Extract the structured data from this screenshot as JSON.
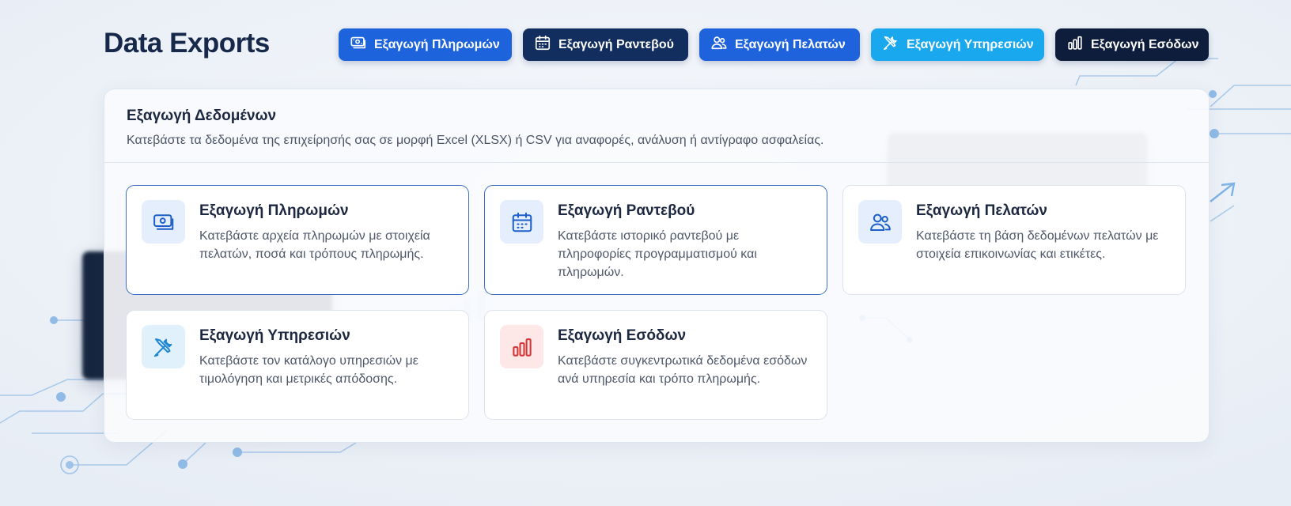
{
  "page": {
    "title": "Data Exports"
  },
  "toolbar": {
    "buttons": [
      {
        "label": "Εξαγωγή Πληρωμών",
        "icon": "cash-icon"
      },
      {
        "label": "Εξαγωγή Ραντεβού",
        "icon": "calendar-icon"
      },
      {
        "label": "Εξαγωγή Πελατών",
        "icon": "users-icon"
      },
      {
        "label": "Εξαγωγή Υπηρεσιών",
        "icon": "tools-icon"
      },
      {
        "label": "Εξαγωγή Εσόδων",
        "icon": "bar-chart-icon"
      }
    ]
  },
  "panel": {
    "title": "Εξαγωγή Δεδομένων",
    "description": "Κατεβάστε τα δεδομένα της επιχείρησής σας σε μορφή Excel (XLSX) ή CSV για αναφορές, ανάλυση ή αντίγραφο ασφαλείας."
  },
  "cards": [
    {
      "title": "Εξαγωγή Πληρωμών",
      "description": "Κατεβάστε αρχεία πληρωμών με στοιχεία πελατών, ποσά και τρόπους πληρωμής.",
      "icon": "cash-icon"
    },
    {
      "title": "Εξαγωγή Ραντεβού",
      "description": "Κατεβάστε ιστορικό ραντεβού με πληροφορίες προγραμματισμού και πληρωμών.",
      "icon": "calendar-icon"
    },
    {
      "title": "Εξαγωγή Πελατών",
      "description": "Κατεβάστε τη βάση δεδομένων πελατών με στοιχεία επικοινωνίας και ετικέτες.",
      "icon": "users-icon"
    },
    {
      "title": "Εξαγωγή Υπηρεσιών",
      "description": "Κατεβάστε τον κατάλογο υπηρεσιών με τιμολόγηση και μετρικές απόδοσης.",
      "icon": "tools-icon"
    },
    {
      "title": "Εξαγωγή Εσόδων",
      "description": "Κατεβάστε συγκεντρωτικά δεδομένα εσόδων ανά υπηρεσία και τρόπο πληρωμής.",
      "icon": "bar-chart-icon"
    }
  ],
  "colors": {
    "brand_dark": "#16294a",
    "primary_blue": "#1d63dc",
    "navy": "#112e5e",
    "sky": "#19a8ee",
    "ink": "#0e1d3c",
    "revenue_red": "#d6383a"
  }
}
